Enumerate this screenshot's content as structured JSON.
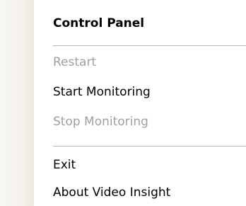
{
  "menu": {
    "items": [
      {
        "label": "Control Panel",
        "enabled": true,
        "default": true
      },
      {
        "label": "Restart",
        "enabled": false
      },
      {
        "label": "Start Monitoring",
        "enabled": true
      },
      {
        "label": "Stop Monitoring",
        "enabled": false
      },
      {
        "label": "Exit",
        "enabled": true
      },
      {
        "label": "About Video Insight",
        "enabled": true
      }
    ]
  },
  "colors": {
    "text": "#000000",
    "disabled_text": "#a3a09c",
    "separator": "#b8b6b1",
    "gutter": "#f3f1ea",
    "background": "#ffffff"
  }
}
